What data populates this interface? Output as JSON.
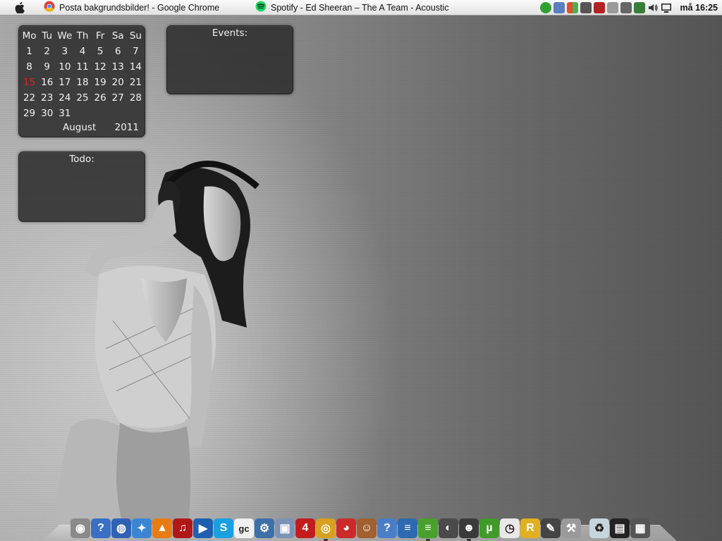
{
  "menubar": {
    "apple_icon": "apple-icon",
    "tasks": [
      {
        "icon": "chrome-icon",
        "label": "Posta bakgrundsbilder! - Google Chrome"
      },
      {
        "icon": "spotify-icon",
        "label": "Spotify - Ed Sheeran – The A Team - Acoustic"
      }
    ],
    "tray_icons": [
      {
        "name": "spotify-tray-icon",
        "color": "#2fa12f"
      },
      {
        "name": "network-disconnected-icon",
        "color": "#5a7fbf"
      },
      {
        "name": "windows-flag-icon",
        "color": "#d9862a"
      },
      {
        "name": "shield-icon",
        "color": "#555555"
      },
      {
        "name": "adobe-icon",
        "color": "#b22222"
      },
      {
        "name": "mute-icon",
        "color": "#777777"
      },
      {
        "name": "display-icon",
        "color": "#666666"
      },
      {
        "name": "safely-remove-icon",
        "color": "#3a7d3a"
      },
      {
        "name": "volume-icon",
        "color": "#333333"
      },
      {
        "name": "action-center-icon",
        "color": "#222222"
      }
    ],
    "clock": "må 16:25"
  },
  "calendar": {
    "weekdays": [
      "Mo",
      "Tu",
      "We",
      "Th",
      "Fr",
      "Sa",
      "Su"
    ],
    "weeks": [
      [
        "1",
        "2",
        "3",
        "4",
        "5",
        "6",
        "7"
      ],
      [
        "8",
        "9",
        "10",
        "11",
        "12",
        "13",
        "14"
      ],
      [
        "15",
        "16",
        "17",
        "18",
        "19",
        "20",
        "21"
      ],
      [
        "22",
        "23",
        "24",
        "25",
        "26",
        "27",
        "28"
      ],
      [
        "29",
        "30",
        "31",
        "",
        "",
        "",
        ""
      ]
    ],
    "today": "15",
    "month": "August",
    "year": "2011"
  },
  "events": {
    "title": "Events:"
  },
  "todo": {
    "title": "Todo:"
  },
  "dock": {
    "items": [
      {
        "name": "speaker-icon",
        "glyph": "◉",
        "bg": "#8a8a8a",
        "running": false
      },
      {
        "name": "help-icon",
        "glyph": "?",
        "bg": "#3a6fc4",
        "running": false
      },
      {
        "name": "network-globe-icon",
        "glyph": "◍",
        "bg": "#2f62b5",
        "running": false
      },
      {
        "name": "safari-icon",
        "glyph": "✦",
        "bg": "#3a86d4",
        "running": false
      },
      {
        "name": "vlc-icon",
        "glyph": "▲",
        "bg": "#e87c14",
        "running": false
      },
      {
        "name": "itunes-icon",
        "glyph": "♫",
        "bg": "#b01818",
        "running": false
      },
      {
        "name": "windows-media-icon",
        "glyph": "▶",
        "bg": "#1f5fb0",
        "running": false
      },
      {
        "name": "skype-icon",
        "glyph": "S",
        "bg": "#1aa0e0",
        "running": false
      },
      {
        "name": "gc-icon",
        "glyph": "gc",
        "bg": "#f0f0f0",
        "running": false
      },
      {
        "name": "settings-gear-icon",
        "glyph": "⚙",
        "bg": "#3d6fa8",
        "running": false
      },
      {
        "name": "drive-icon",
        "glyph": "▣",
        "bg": "#7d93b5",
        "running": false
      },
      {
        "name": "left4dead-icon",
        "glyph": "4",
        "bg": "#c21d1d",
        "running": false
      },
      {
        "name": "chrome-dock-icon",
        "glyph": "◎",
        "bg": "#d8a020",
        "running": true
      },
      {
        "name": "angry-birds-icon",
        "glyph": "◕",
        "bg": "#cc2a2a",
        "running": false
      },
      {
        "name": "game-character-icon",
        "glyph": "☺",
        "bg": "#a06030",
        "running": false
      },
      {
        "name": "help-2-icon",
        "glyph": "?",
        "bg": "#4a7fc8",
        "running": false
      },
      {
        "name": "tool-icon",
        "glyph": "≡",
        "bg": "#2f6ab0",
        "running": false
      },
      {
        "name": "spotify-dock-icon",
        "glyph": "≡",
        "bg": "#4aa02c",
        "running": true
      },
      {
        "name": "steam-icon",
        "glyph": "◐",
        "bg": "#4a4a4a",
        "running": false
      },
      {
        "name": "messenger-icon",
        "glyph": "☻",
        "bg": "#3a3a3a",
        "running": true
      },
      {
        "name": "utorrent-icon",
        "glyph": "µ",
        "bg": "#3f9a2a",
        "running": false
      },
      {
        "name": "clock-icon",
        "glyph": "◷",
        "bg": "#e8e8e8",
        "running": false
      },
      {
        "name": "rockstar-icon",
        "glyph": "R",
        "bg": "#e0b020",
        "running": false
      },
      {
        "name": "pen-icon",
        "glyph": "✎",
        "bg": "#444444",
        "running": false
      },
      {
        "name": "tools-icon",
        "glyph": "⚒",
        "bg": "#9a9a9a",
        "running": false
      },
      {
        "name": "recycle-bin-icon",
        "glyph": "♻",
        "bg": "#c8d4dc",
        "running": false
      },
      {
        "name": "window-switcher-icon",
        "glyph": "▤",
        "bg": "#222222",
        "running": false
      },
      {
        "name": "desktop-stack-icon",
        "glyph": "▦",
        "bg": "#555555",
        "running": false
      }
    ]
  }
}
